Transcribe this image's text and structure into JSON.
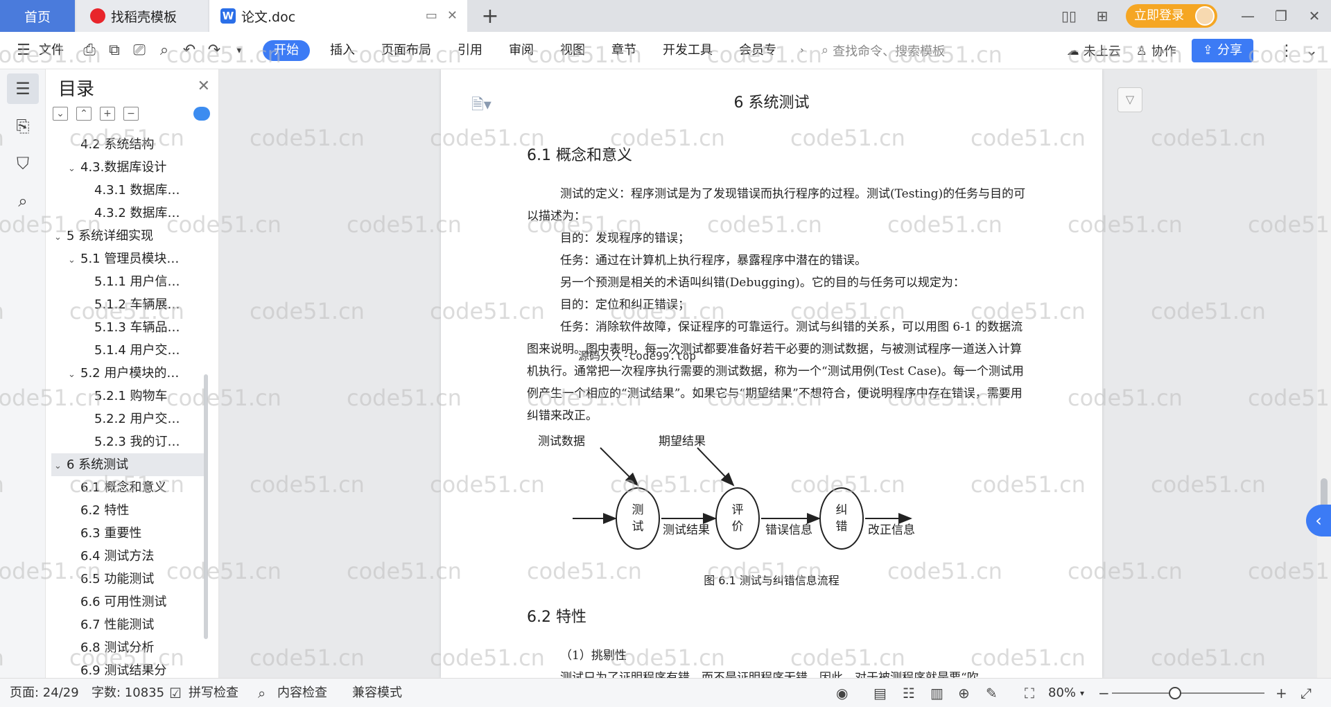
{
  "tabs": {
    "home": "首页",
    "template": "找稻壳模板",
    "doc": "论文.doc"
  },
  "login_label": "立即登录",
  "menu": {
    "file": "文件",
    "start": "开始",
    "insert": "插入",
    "layout": "页面布局",
    "reference": "引用",
    "review": "审阅",
    "view": "视图",
    "section": "章节",
    "devtools": "开发工具",
    "member": "会员专",
    "search_placeholder": "查找命令、搜索模板",
    "cloud": "未上云",
    "collab": "协作",
    "share": "分享"
  },
  "toc": {
    "title": "目录",
    "items": [
      {
        "label": "4.2 系统结构",
        "level": 2,
        "caret": ""
      },
      {
        "label": "4.3.数据库设计",
        "level": 2,
        "caret": "v"
      },
      {
        "label": "4.3.1 数据库…",
        "level": 3,
        "caret": ""
      },
      {
        "label": "4.3.2 数据库…",
        "level": 3,
        "caret": ""
      },
      {
        "label": "5 系统详细实现",
        "level": 1,
        "caret": "v"
      },
      {
        "label": "5.1 管理员模块…",
        "level": 2,
        "caret": "v"
      },
      {
        "label": "5.1.1 用户信…",
        "level": 3,
        "caret": ""
      },
      {
        "label": "5.1.2 车辆展…",
        "level": 3,
        "caret": ""
      },
      {
        "label": "5.1.3 车辆品…",
        "level": 3,
        "caret": ""
      },
      {
        "label": "5.1.4 用户交…",
        "level": 3,
        "caret": ""
      },
      {
        "label": "5.2 用户模块的…",
        "level": 2,
        "caret": "v"
      },
      {
        "label": "5.2.1 购物车",
        "level": 3,
        "caret": ""
      },
      {
        "label": "5.2.2 用户交…",
        "level": 3,
        "caret": ""
      },
      {
        "label": "5.2.3 我的订…",
        "level": 3,
        "caret": ""
      },
      {
        "label": "6 系统测试",
        "level": 1,
        "caret": "v",
        "selected": true
      },
      {
        "label": "6.1 概念和意义",
        "level": 2,
        "caret": ""
      },
      {
        "label": "6.2 特性",
        "level": 2,
        "caret": ""
      },
      {
        "label": "6.3 重要性",
        "level": 2,
        "caret": ""
      },
      {
        "label": "6.4 测试方法",
        "level": 2,
        "caret": ""
      },
      {
        "label": "6.5 功能测试",
        "level": 2,
        "caret": ""
      },
      {
        "label": "6.6 可用性测试",
        "level": 2,
        "caret": ""
      },
      {
        "label": "6.7 性能测试",
        "level": 2,
        "caret": ""
      },
      {
        "label": "6.8 测试分析",
        "level": 2,
        "caret": ""
      },
      {
        "label": "6.9 测试结果分",
        "level": 2,
        "caret": ""
      }
    ]
  },
  "doc": {
    "chapter_title": "6 系统测试",
    "h_6_1": "6.1 概念和意义",
    "p1": "测试的定义：程序测试是为了发现错误而执行程序的过程。测试(Testing)的任务与目的可以描述为：",
    "p2": "目的：发现程序的错误；",
    "p3": "任务：通过在计算机上执行程序，暴露程序中潜在的错误。",
    "p4": "另一个预测是相关的术语叫纠错(Debugging)。它的目的与任务可以规定为：",
    "p5": "目的：定位和纠正错误；",
    "p6": "任务：消除软件故障，保证程序的可靠运行。测试与纠错的关系，可以用图 6-1 的数据流图来说明。图中表明，每一次测试都要准备好若干必要的测试数据，与被测试程序一道送入计算机执行。通常把一次程序执行需要的测试数据，称为一个“测试用例(Test Case)。每一个测试用例产生一个相应的“测试结果”。如果它与“期望结果”不想符合，便说明程序中存在错误，需要用纠错来改正。",
    "overlay_note": "源码久久-code99.top",
    "figure": {
      "input_test_data": "测试数据",
      "input_expected": "期望结果",
      "node_test": [
        "测",
        "试"
      ],
      "node_eval": [
        "评",
        "价"
      ],
      "node_fix": [
        "纠",
        "错"
      ],
      "edge_result": "测试结果",
      "edge_error": "错误信息",
      "edge_fixinfo": "改正信息"
    },
    "fig_caption": "图 6.1 测试与纠错信息流程",
    "h_6_2": "6.2 特性",
    "p7": "（1）挑剔性",
    "p8": "测试只为了证明程序有错，而不是证明程序无错。因此，对于被测程序就是要“吹"
  },
  "watermark_text": "code51.cn",
  "status": {
    "page": "页面: 24/29",
    "words": "字数: 10835",
    "spell": "拼写检查",
    "content_check": "内容检查",
    "compat": "兼容模式",
    "zoom": "80%"
  },
  "colors": {
    "accent": "#3c7bf5",
    "login": "#f5a623",
    "home_tab": "#4a7bdc"
  }
}
